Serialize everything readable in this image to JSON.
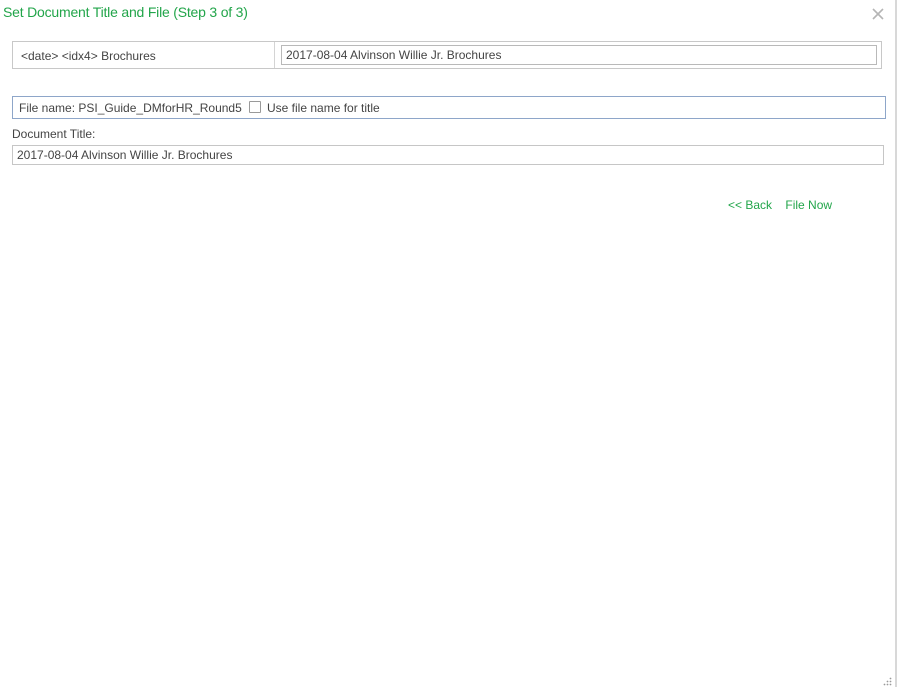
{
  "dialog": {
    "title": "Set Document Title and File (Step 3 of 3)"
  },
  "template": {
    "label": "<date> <idx4> Brochures",
    "value": "2017-08-04 Alvinson Willie Jr. Brochures"
  },
  "file": {
    "label": "File name: PSI_Guide_DMforHR_Round5",
    "use_file_name_label": "Use file name for title",
    "use_file_name_checked": false
  },
  "document_title": {
    "label": "Document Title:",
    "value": "2017-08-04 Alvinson Willie Jr. Brochures"
  },
  "actions": {
    "back_label": "<< Back",
    "file_now_label": "File Now"
  },
  "colors": {
    "accent": "#22a54a",
    "focus_border": "#8ea6c9"
  },
  "icons": {
    "close": "close-icon",
    "resize": "resize-grip-icon"
  }
}
